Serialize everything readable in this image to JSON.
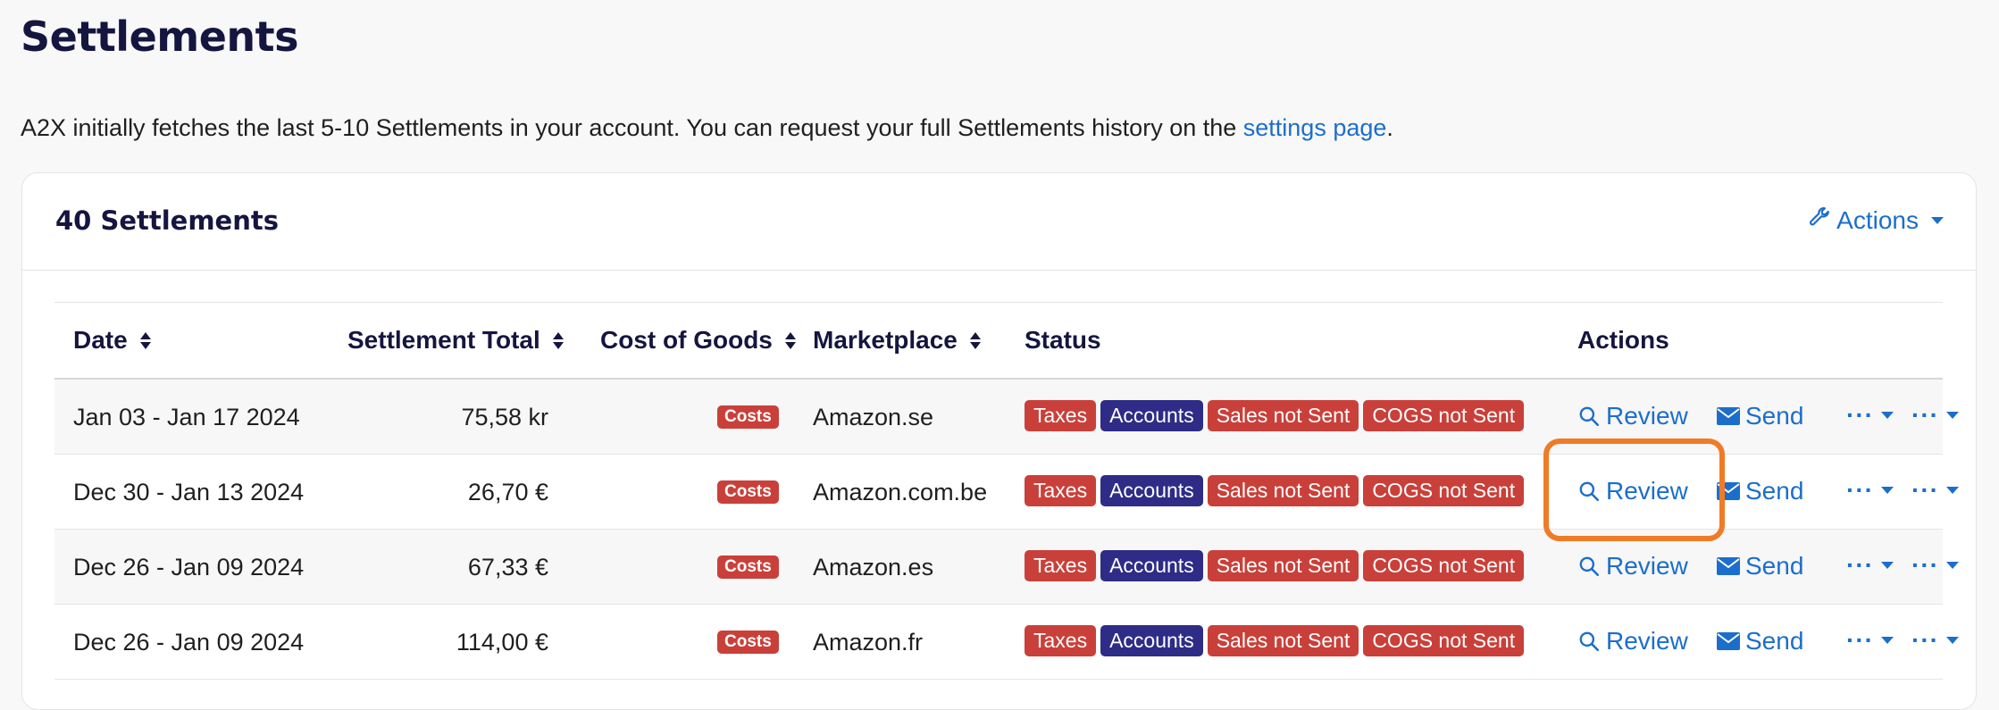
{
  "page": {
    "title": "Settlements",
    "intro_text": "A2X initially fetches the last 5-10 Settlements in your account. You can request your full Settlements history on the ",
    "intro_link": "settings page",
    "intro_end": "."
  },
  "card": {
    "title": "40 Settlements",
    "actions_label": "Actions"
  },
  "table": {
    "headers": {
      "date": "Date",
      "total": "Settlement Total",
      "cogs": "Cost of Goods",
      "marketplace": "Marketplace",
      "status": "Status",
      "actions": "Actions"
    },
    "costs_label": "Costs",
    "status_labels": [
      "Taxes",
      "Accounts",
      "Sales not Sent",
      "COGS not Sent"
    ],
    "review_label": "Review",
    "send_label": "Send",
    "dots_label": "···",
    "rows": [
      {
        "date": "Jan 03 - Jan 17 2024",
        "total": "75,58 kr",
        "marketplace": "Amazon.se"
      },
      {
        "date": "Dec 30 - Jan 13 2024",
        "total": "26,70 €",
        "marketplace": "Amazon.com.be"
      },
      {
        "date": "Dec 26 - Jan 09 2024",
        "total": "67,33 €",
        "marketplace": "Amazon.es"
      },
      {
        "date": "Dec 26 - Jan 09 2024",
        "total": "114,00 €",
        "marketplace": "Amazon.fr"
      }
    ]
  },
  "colors": {
    "accent": "#1c6ecb",
    "badge_red": "#c9403a",
    "badge_navy": "#2e2c86",
    "highlight": "#f07b26"
  }
}
